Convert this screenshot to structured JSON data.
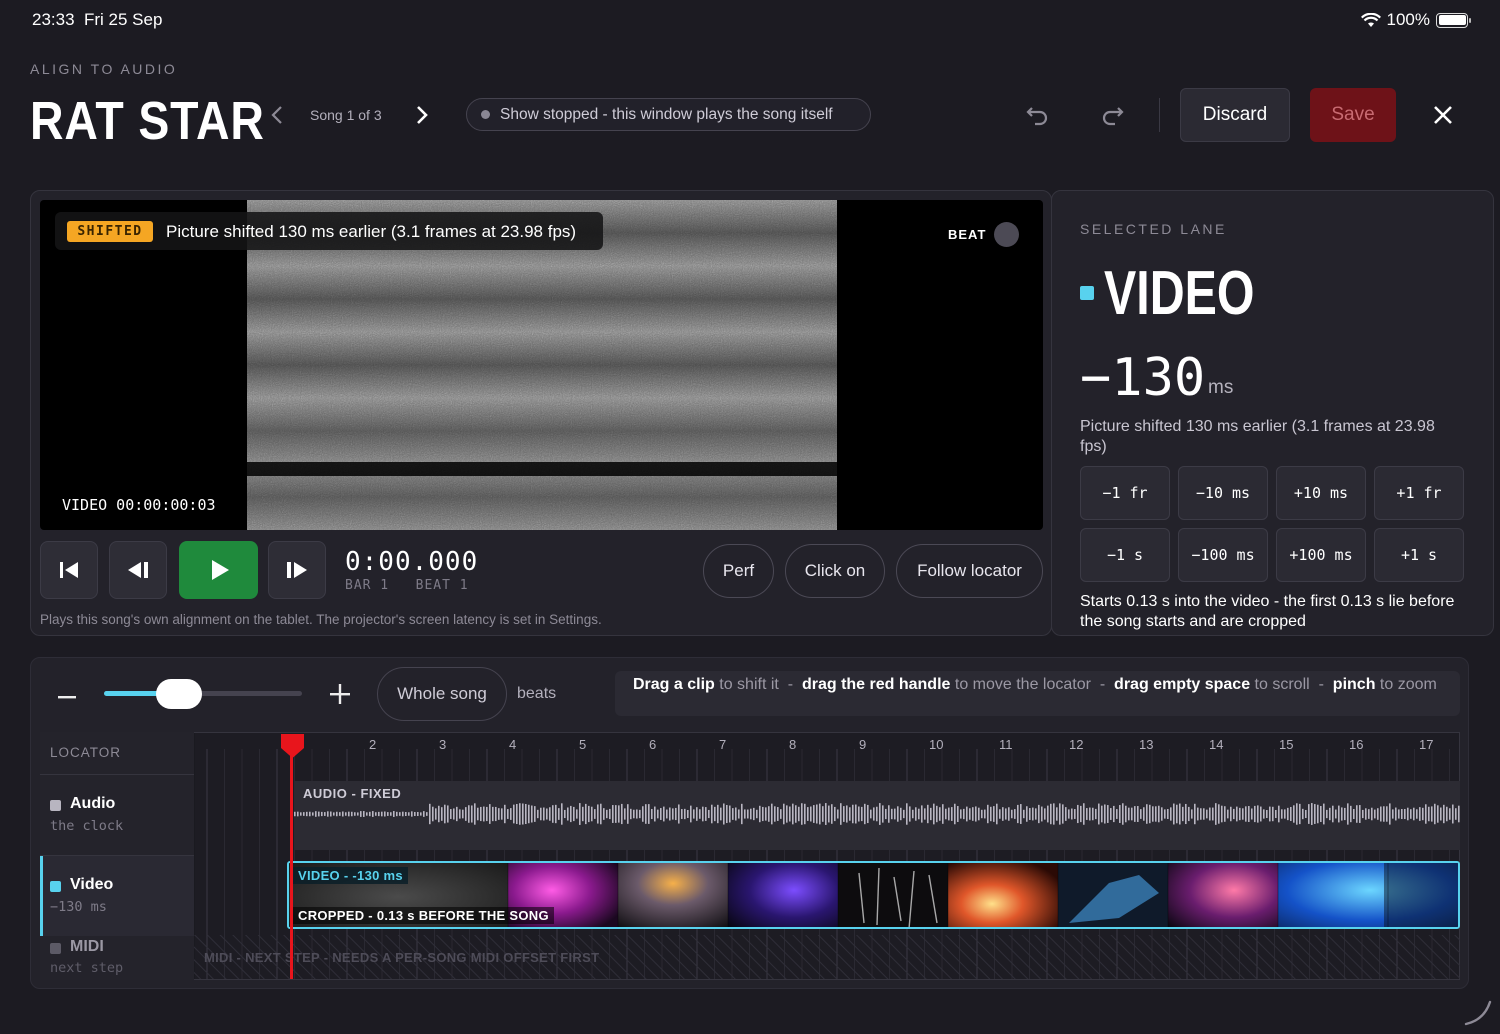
{
  "status": {
    "time": "23:33",
    "date": "Fri 25 Sep",
    "battery": "100%"
  },
  "header": {
    "kicker": "ALIGN TO AUDIO",
    "title": "RAT STAR",
    "song_count": "Song 1 of 3",
    "show_status": "Show stopped - this window plays the song itself",
    "discard": "Discard",
    "save": "Save"
  },
  "player": {
    "badge": "SHIFTED",
    "shift_text": "Picture shifted 130 ms earlier (3.1 frames at 23.98 fps)",
    "beat_label": "BEAT",
    "timecode": "VIDEO 00:00:00:03",
    "clock": "0:00.000",
    "bar_beat": "BAR 1   BEAT 1",
    "perf": "Perf",
    "click": "Click on",
    "follow": "Follow locator",
    "hint": "Plays this song's own alignment on the tablet. The projector's screen latency is set in Settings."
  },
  "lane_panel": {
    "kicker": "SELECTED LANE",
    "name": "VIDEO",
    "offset": "−130",
    "unit": "ms",
    "desc": "Picture shifted 130 ms earlier (3.1 frames at 23.98 fps)",
    "nudges": [
      "−1 fr",
      "−10 ms",
      "+10 ms",
      "+1 fr",
      "−1 s",
      "−100 ms",
      "+100 ms",
      "+1 s"
    ],
    "starts": "Starts 0.13 s into the video - the first 0.13 s lie before the song starts and are cropped",
    "accent": "#58d2ee"
  },
  "timeline": {
    "zoom_level": 0.38,
    "whole_song": "Whole song",
    "beats": "beats",
    "tip": [
      {
        "b": "Drag a clip",
        "t": " to shift it  -  "
      },
      {
        "b": "drag the red handle",
        "t": " to move the locator  -  "
      },
      {
        "b": "drag empty space",
        "t": " to scroll  -  "
      },
      {
        "b": "pinch",
        "t": " to zoom"
      }
    ],
    "locator_label": "LOCATOR",
    "ruler": [
      "2",
      "3",
      "4",
      "5",
      "6",
      "7",
      "8",
      "9",
      "10",
      "11",
      "12",
      "13",
      "14",
      "15",
      "16",
      "17"
    ],
    "lanes": {
      "audio": {
        "name": "Audio",
        "sub": "the clock",
        "clip": "AUDIO - FIXED"
      },
      "video": {
        "name": "Video",
        "sub": "−130 ms",
        "clip": "VIDEO - -130 ms",
        "crop": "CROPPED - 0.13 s BEFORE THE SONG"
      },
      "midi": {
        "name": "MIDI",
        "sub": "next step",
        "note": "MIDI - NEXT STEP - NEEDS A PER-SONG MIDI OFFSET FIRST"
      }
    },
    "playhead_color": "#e8151c"
  }
}
